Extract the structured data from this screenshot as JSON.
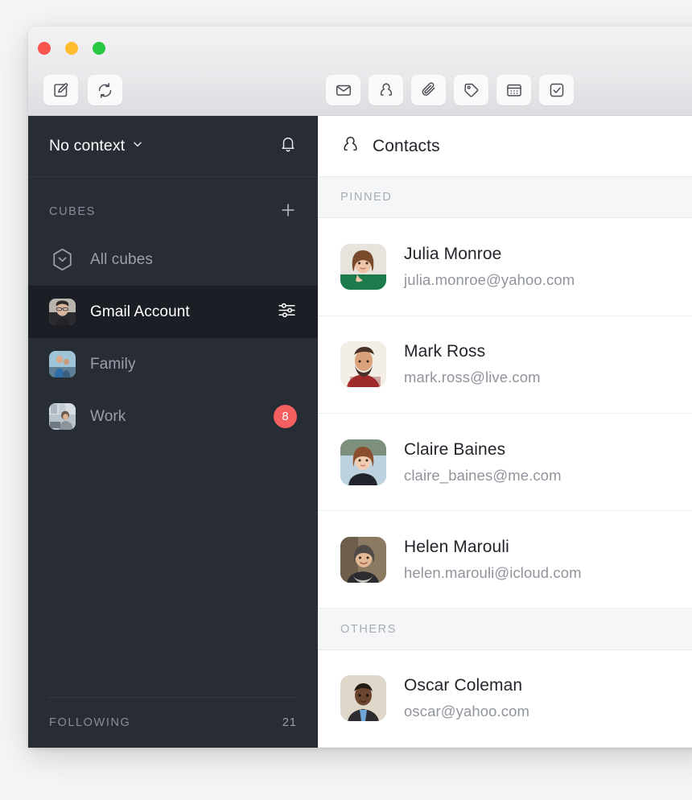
{
  "window": {
    "traffic_lights": [
      {
        "name": "close",
        "color": "#f9554f"
      },
      {
        "name": "minimize",
        "color": "#febc2e"
      },
      {
        "name": "zoom",
        "color": "#28c840"
      }
    ],
    "left_buttons": [
      {
        "name": "compose-button",
        "icon": "compose-icon"
      },
      {
        "name": "sync-button",
        "icon": "sync-icon"
      }
    ],
    "center_buttons": [
      {
        "name": "mail-tab",
        "icon": "envelope-icon"
      },
      {
        "name": "contacts-tab",
        "icon": "person-icon"
      },
      {
        "name": "attachments-tab",
        "icon": "paperclip-icon"
      },
      {
        "name": "labels-tab",
        "icon": "tag-icon"
      },
      {
        "name": "calendar-tab",
        "icon": "calendar-icon"
      },
      {
        "name": "tasks-tab",
        "icon": "checkbox-icon"
      }
    ]
  },
  "sidebar": {
    "context": {
      "label": "No context",
      "chevron": "chevron-down-icon",
      "bell": "bell-icon"
    },
    "cubes_section": {
      "title": "CUBES",
      "add_icon": "plus-icon"
    },
    "cubes": [
      {
        "label": "All cubes",
        "icon": "hexagon-icon",
        "selected": false,
        "badge": "",
        "settings": false
      },
      {
        "label": "Gmail Account",
        "icon": "avatar-man-glasses",
        "selected": true,
        "badge": "",
        "settings": true
      },
      {
        "label": "Family",
        "icon": "avatar-family",
        "selected": false,
        "badge": "",
        "settings": false
      },
      {
        "label": "Work",
        "icon": "avatar-work-desk",
        "selected": false,
        "badge": "8",
        "settings": false
      }
    ],
    "following": {
      "title": "FOLLOWING",
      "count": "21"
    }
  },
  "content": {
    "header": {
      "title": "Contacts",
      "icon": "person-icon"
    },
    "sections": [
      {
        "title": "PINNED",
        "contacts": [
          {
            "name": "Julia Monroe",
            "email": "julia.monroe@yahoo.com",
            "avatar": "avatar-julia",
            "unread": true
          },
          {
            "name": "Mark Ross",
            "email": "mark.ross@live.com",
            "avatar": "avatar-mark",
            "unread": false
          },
          {
            "name": "Claire Baines",
            "email": "claire_baines@me.com",
            "avatar": "avatar-claire",
            "unread": false
          },
          {
            "name": "Helen Marouli",
            "email": "helen.marouli@icloud.com",
            "avatar": "avatar-helen",
            "unread": false
          }
        ]
      },
      {
        "title": "OTHERS",
        "contacts": [
          {
            "name": "Oscar Coleman",
            "email": "oscar@yahoo.com",
            "avatar": "avatar-oscar",
            "unread": false
          }
        ]
      }
    ]
  },
  "colors": {
    "sidebar_bg": "#282c35",
    "sidebar_selected_bg": "#1b1e25",
    "badge_red": "#f4605f",
    "text_primary": "#22252b",
    "text_muted": "#90949c",
    "section_bg": "#f5f6f8"
  }
}
